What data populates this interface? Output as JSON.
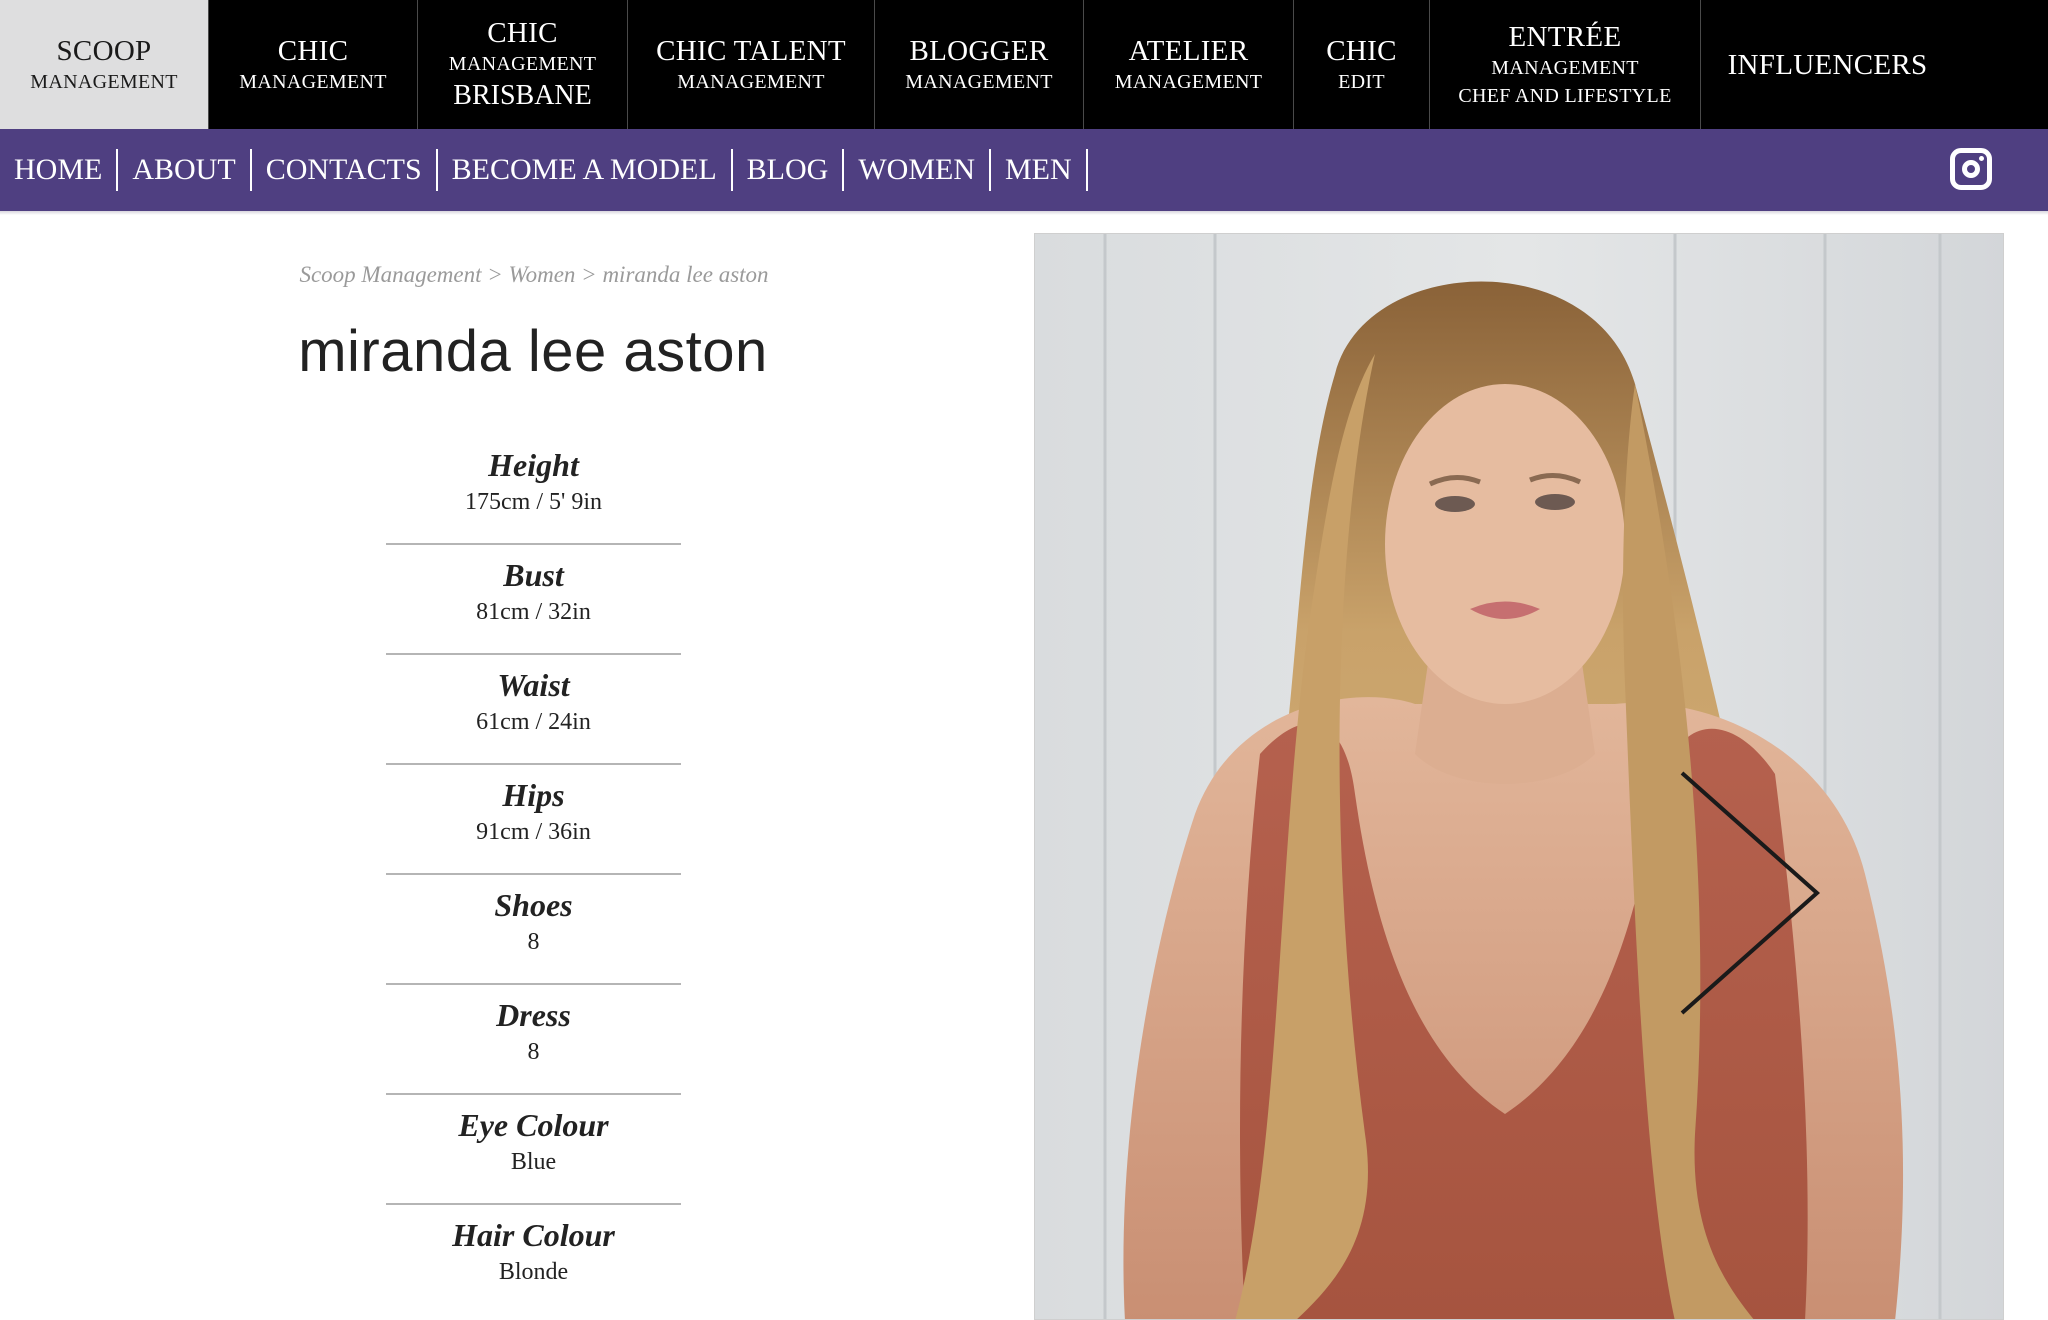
{
  "agencies": [
    {
      "line1": "SCOOP",
      "line2": "MANAGEMENT",
      "line3": "",
      "active": true
    },
    {
      "line1": "CHIC",
      "line2": "MANAGEMENT",
      "line3": ""
    },
    {
      "line1": "CHIC",
      "line2": "MANAGEMENT",
      "line3": "BRISBANE"
    },
    {
      "line1": "CHIC TALENT",
      "line2": "MANAGEMENT",
      "line3": ""
    },
    {
      "line1": "BLOGGER",
      "line2": "MANAGEMENT",
      "line3": ""
    },
    {
      "line1": "ATELIER",
      "line2": "MANAGEMENT",
      "line3": ""
    },
    {
      "line1": "CHIC",
      "line2": "EDIT",
      "line3": ""
    },
    {
      "line1": "ENTRÉE",
      "line2": "MANAGEMENT",
      "line3": "CHEF AND LIFESTYLE"
    },
    {
      "line1": "INFLUENCERS",
      "line2": "",
      "line3": ""
    }
  ],
  "nav": {
    "items": [
      "HOME",
      "ABOUT",
      "CONTACTS",
      "BECOME A MODEL",
      "BLOG",
      "WOMEN",
      "MEN"
    ],
    "instagram_icon": "instagram-icon"
  },
  "breadcrumb": {
    "items": [
      "Scoop Management",
      "Women",
      "miranda lee aston"
    ],
    "separator": ">"
  },
  "model": {
    "name": "miranda lee aston",
    "stats": [
      {
        "label": "Height",
        "value": "175cm / 5' 9in"
      },
      {
        "label": "Bust",
        "value": "81cm / 32in"
      },
      {
        "label": "Waist",
        "value": "61cm / 24in"
      },
      {
        "label": "Hips",
        "value": "91cm / 36in"
      },
      {
        "label": "Shoes",
        "value": "8"
      },
      {
        "label": "Dress",
        "value": "8"
      },
      {
        "label": "Eye Colour",
        "value": "Blue"
      },
      {
        "label": "Hair Colour",
        "value": "Blonde"
      }
    ]
  },
  "gallery": {
    "next_icon": "chevron-right-icon"
  },
  "colors": {
    "agency_bar": "#000000",
    "agency_active": "#dededf",
    "nav_purple": "#4f3f81",
    "breadcrumb_grey": "#9a9a9a"
  }
}
